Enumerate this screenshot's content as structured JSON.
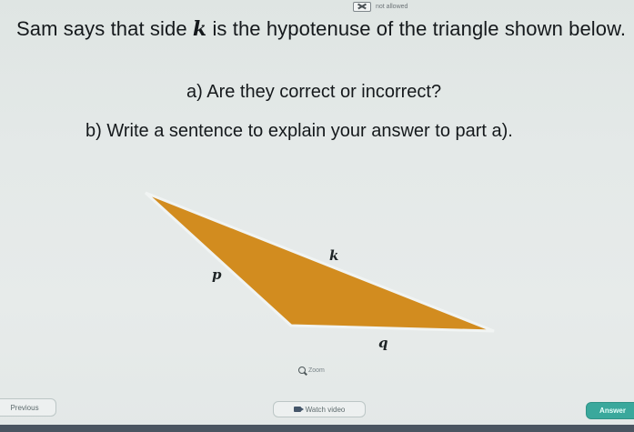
{
  "status": {
    "note": "not allowed"
  },
  "question": {
    "line1_prefix": "Sam says that side ",
    "side_name": "k",
    "line1_suffix": " is the hypotenuse of the triangle shown below.",
    "part_a": "a) Are they correct or incorrect?",
    "part_b": "b) Write a sentence to explain your answer to part a)."
  },
  "diagram": {
    "fill": "#d28c1f",
    "stroke": "#f1f4f3",
    "labels": {
      "k": "k",
      "p": "p",
      "q": "q"
    }
  },
  "controls": {
    "zoom": "Zoom",
    "previous": "Previous",
    "watch_video": "Watch video",
    "answer": "Answer"
  },
  "colors": {
    "background": "#e4e9e8",
    "answer": "#3aa89c",
    "text": "#1b1f22"
  }
}
